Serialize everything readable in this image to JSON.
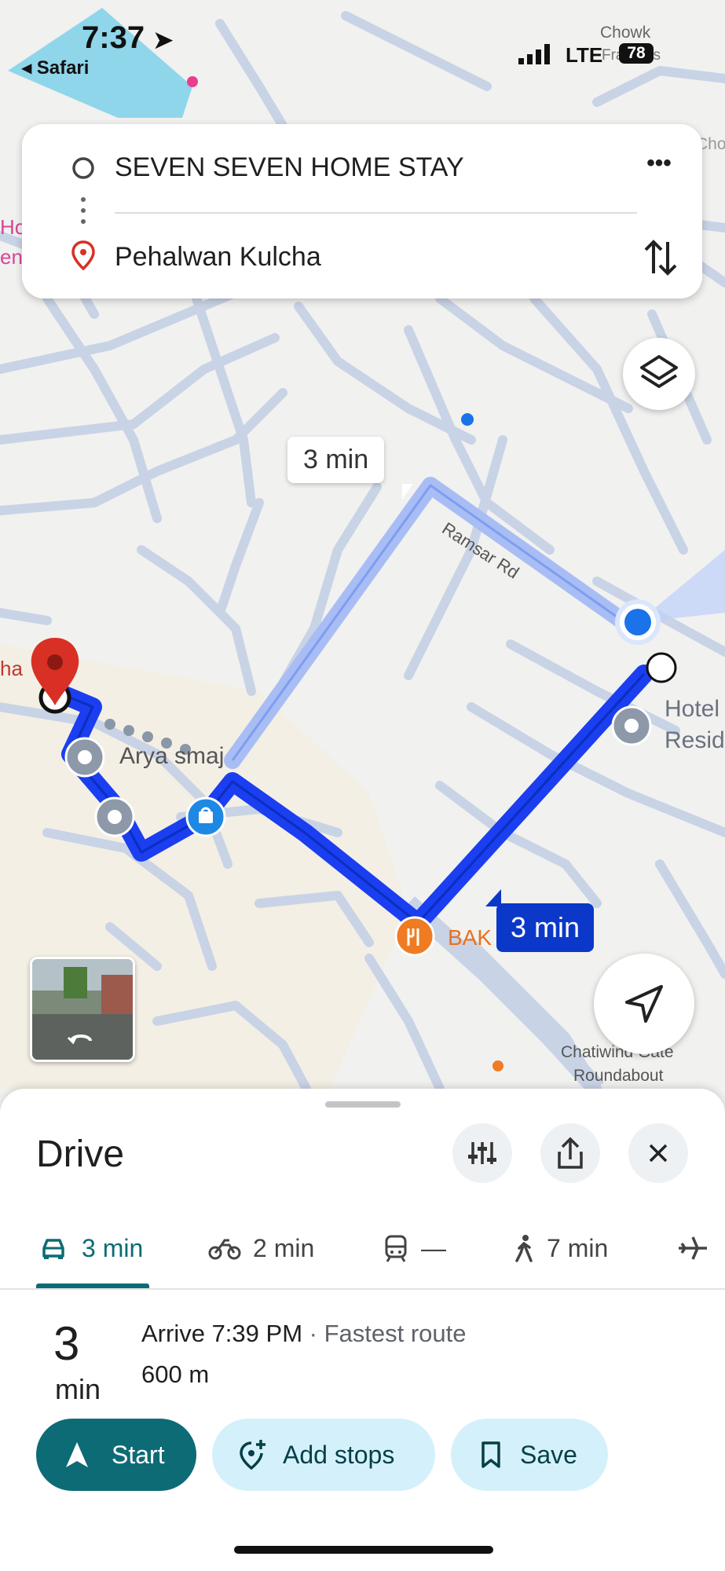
{
  "status_bar": {
    "time": "7:37",
    "back_label": "Safari",
    "network": "LTE",
    "battery": "78"
  },
  "search": {
    "origin": "SEVEN SEVEN HOME STAY",
    "destination": "Pehalwan Kulcha"
  },
  "map": {
    "eta_alt": "3 min",
    "eta_main": "3 min",
    "labels": {
      "road": "Ramsar Rd",
      "arya": "Arya smaj",
      "bak": "BAK",
      "hotel": "Hotel",
      "resid": "Resid",
      "chatiwind_1": "Chatiwind Gate",
      "chatiwind_2": "Roundabout",
      "chowk_1": "Chowk",
      "chowk_2": "Fragrass",
      "cho": "Cho",
      "ho": "Ho",
      "en": "en",
      "ha": "ha"
    },
    "colors": {
      "route": "#1a3ef0",
      "route_alt": "#a9bdf5",
      "pin": "#d93025",
      "you": "#1a73e8"
    }
  },
  "sheet": {
    "title": "Drive",
    "tabs": [
      {
        "icon": "car-icon",
        "label": "3 min"
      },
      {
        "icon": "motorbike-icon",
        "label": "2 min"
      },
      {
        "icon": "train-icon",
        "label": "—"
      },
      {
        "icon": "walk-icon",
        "label": "7 min"
      },
      {
        "icon": "plane-icon",
        "label": ""
      }
    ],
    "duration_value": "3",
    "duration_unit": "min",
    "arrive": "Arrive 7:39 PM",
    "route_note": "· Fastest route",
    "distance": "600 m",
    "buttons": {
      "start": "Start",
      "add_stops": "Add stops",
      "save": "Save"
    }
  }
}
